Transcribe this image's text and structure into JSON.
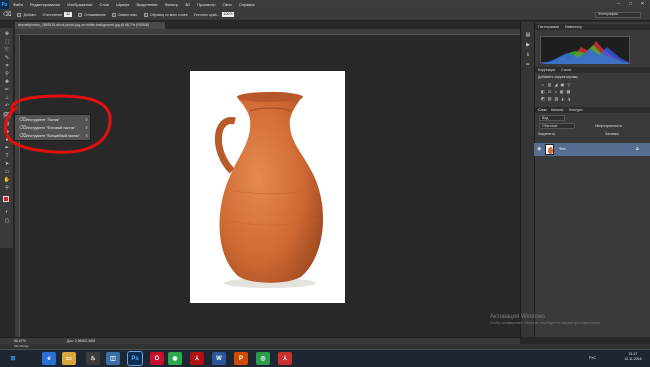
{
  "app": {
    "logo": "Ps",
    "menu": [
      "Файл",
      "Редактирование",
      "Изображение",
      "Слои",
      "Шрифт",
      "Выделение",
      "Фильтр",
      "3D",
      "Просмотр",
      "Окно",
      "Справка"
    ]
  },
  "options": {
    "add_label": "Добавл.",
    "opacity_label": "Отклонение",
    "opacity_value": "32",
    "antialias_label": "Сглаживание",
    "contiguous_label": "Смежн.пикс.",
    "all_layers_label": "Образец со всех слоев",
    "refine_label": "Уточнить край...",
    "zoom_value": "100%",
    "workspace": "Фотография"
  },
  "document": {
    "tab_title": "depositphotos_2865118-stock-photo-jug-on-white-background.jpg @ 66,7% (RGB/8)",
    "zoom": "66,67%",
    "doc_size": "Док: 2,36M/2,36M"
  },
  "flyout": {
    "items": [
      {
        "label": "Инструмент \"Ластик\"",
        "key": "E"
      },
      {
        "label": "Инструмент \"Фоновый ластик\"",
        "key": "E"
      },
      {
        "label": "Инструмент \"Волшебный ластик\"",
        "key": "E"
      }
    ]
  },
  "panels": {
    "top_tabs": [
      "Гистограмма",
      "Навигатор"
    ],
    "adjust_tabs": [
      "Коррекция",
      "Стили"
    ],
    "adjust_title": "Добавить корректировку",
    "layers_tabs": [
      "Слои",
      "Каналы",
      "Контуры"
    ],
    "filter_label": "Вид",
    "blend_mode": "Обычные",
    "opacity_label": "Непрозрачность:",
    "lock_label": "Закрепить:",
    "fill_label": "Заливка:",
    "layer_name": "Фон"
  },
  "bottom": {
    "mini_bridge": "Mini Bridge"
  },
  "watermark": {
    "title": "Активация Windows",
    "text": "Чтобы активировать Windows, перейдите в параметры компьютера."
  },
  "taskbar": {
    "lang": "РУС",
    "time": "21:17",
    "date": "12.11.2016"
  },
  "colors": {
    "annotation_red": "#e01010",
    "jug_orange": "#d4703c",
    "layer_selected": "#556d8f"
  }
}
